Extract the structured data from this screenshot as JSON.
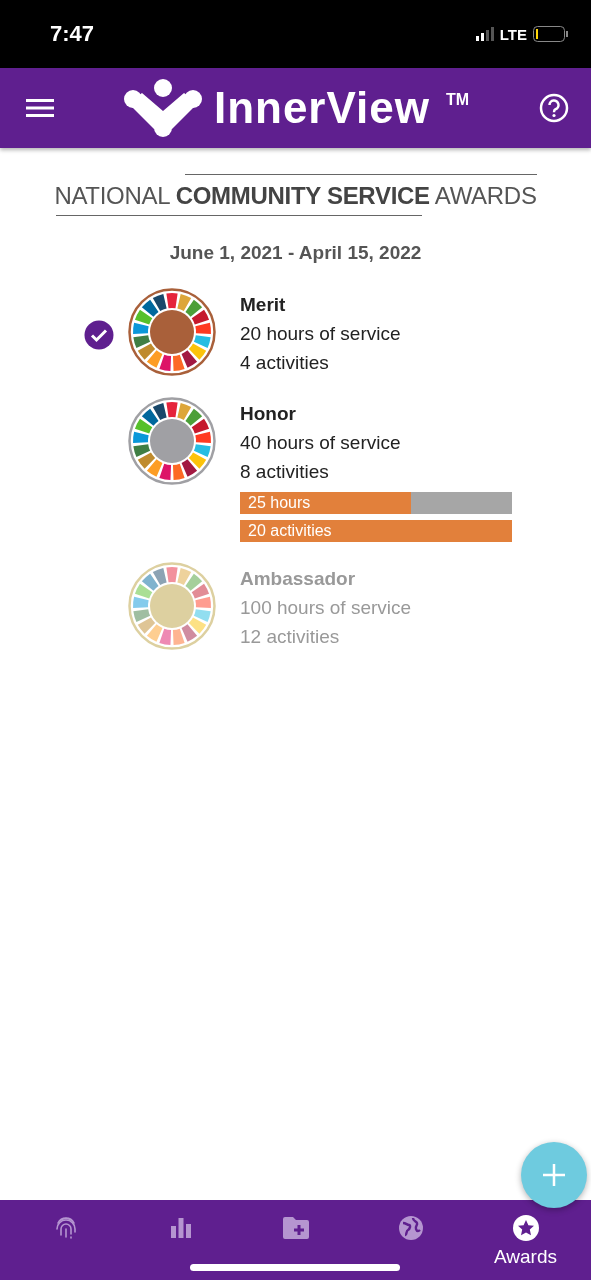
{
  "status_bar": {
    "time": "7:47",
    "network": "LTE"
  },
  "app_bar": {
    "title": "InnerView",
    "trademark": "TM"
  },
  "banner": {
    "title": "NATIONAL **COMMUNITY SERVICE** AWARDS"
  },
  "date_range": "June 1, 2021 - April 15, 2022",
  "awards": [
    {
      "name": "Merit",
      "hours": "20 hours of service",
      "activities": "4 activities",
      "earned": true,
      "locked": false,
      "color": "#a9603a"
    },
    {
      "name": "Honor",
      "hours": "40 hours of service",
      "activities": "8 activities",
      "earned": false,
      "locked": false,
      "color": "#a0a0a4",
      "progress": [
        {
          "label": "25 hours",
          "level": 0.63
        },
        {
          "label": "20 activities",
          "level": 1.0
        }
      ]
    },
    {
      "name": "Ambassador",
      "hours": "100 hours of service",
      "activities": "12 activities",
      "earned": false,
      "locked": true,
      "color": "#ddd0a0"
    }
  ],
  "bottom_nav": [
    {
      "kind": "fingerprint",
      "selected": false
    },
    {
      "kind": "chart",
      "selected": false
    },
    {
      "kind": "folder-add",
      "selected": false
    },
    {
      "kind": "globe",
      "selected": false
    },
    {
      "kind": "star",
      "label": "Awards",
      "selected": true
    }
  ]
}
